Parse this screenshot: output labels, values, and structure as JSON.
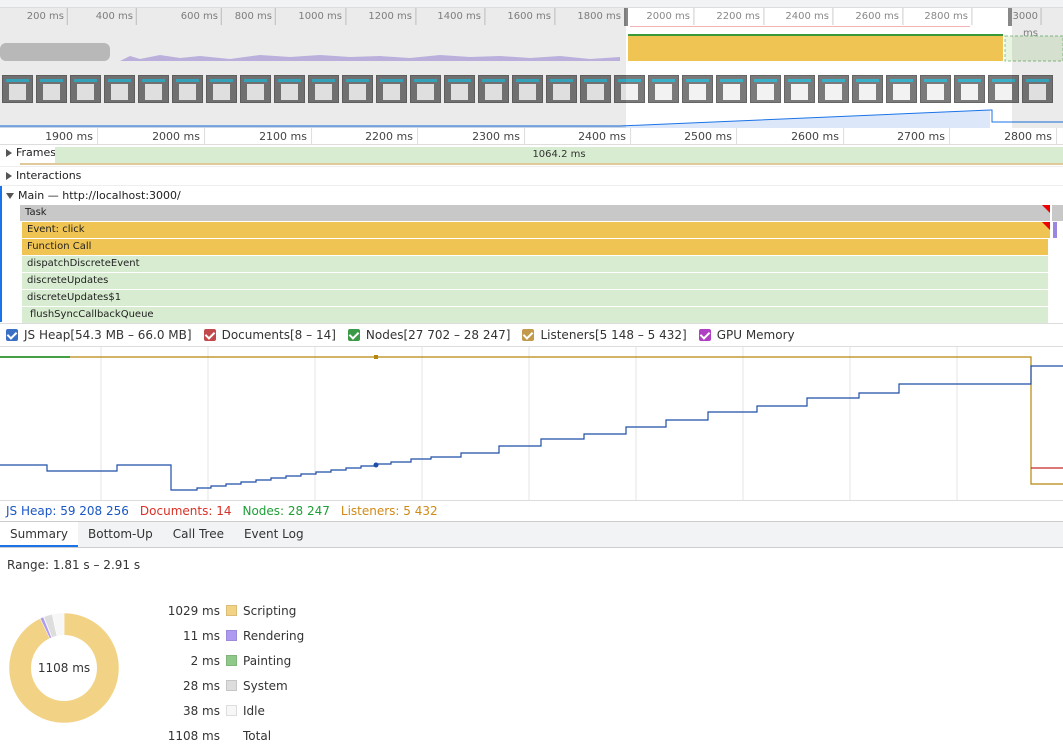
{
  "overview": {
    "ticks": [
      "200 ms",
      "400 ms",
      "600 ms",
      "800 ms",
      "1000 ms",
      "1200 ms",
      "1400 ms",
      "1600 ms",
      "1800 ms",
      "2000 ms",
      "2200 ms",
      "2400 ms",
      "2600 ms",
      "2800 ms",
      "3000 ms"
    ]
  },
  "ruler": {
    "ticks": [
      "1900 ms",
      "2000 ms",
      "2100 ms",
      "2200 ms",
      "2300 ms",
      "2400 ms",
      "2500 ms",
      "2600 ms",
      "2700 ms",
      "2800 ms"
    ]
  },
  "tracks": {
    "frames": {
      "label": "Frames",
      "duration": "1064.2 ms"
    },
    "interactions": {
      "label": "Interactions"
    },
    "main": {
      "label": "Main — http://localhost:3000/"
    }
  },
  "flame": {
    "task": "Task",
    "event_click": "Event: click",
    "function_call": "Function Call",
    "dispatch": "dispatchDiscreteEvent",
    "discrete_updates": "discreteUpdates",
    "discrete_updates1": "discreteUpdates$1",
    "flush_sync": "flushSyncCallbackQueue"
  },
  "counters": {
    "js_heap": {
      "label": "JS Heap[54.3 MB – 66.0 MB]",
      "color": "#1a73e8"
    },
    "documents": {
      "label": "Documents[8 – 14]",
      "color": "#d93025"
    },
    "nodes": {
      "label": "Nodes[27 702 – 28 247]",
      "color": "#188038"
    },
    "listeners": {
      "label": "Listeners[5 148 – 5 432]",
      "color": "#e8a33d"
    },
    "gpu": {
      "label": "GPU Memory",
      "color": "#b03ec2"
    }
  },
  "counter_values": {
    "js_heap": "JS Heap: 59 208 256",
    "documents": "Documents: 14",
    "nodes": "Nodes: 28 247",
    "listeners": "Listeners: 5 432"
  },
  "tabs": [
    "Summary",
    "Bottom-Up",
    "Call Tree",
    "Event Log"
  ],
  "summary": {
    "range": "Range: 1.81 s – 2.91 s",
    "total_center": "1108 ms",
    "rows": [
      {
        "ms": "1029 ms",
        "label": "Scripting",
        "color": "#f2d386"
      },
      {
        "ms": "11 ms",
        "label": "Rendering",
        "color": "#af9af2"
      },
      {
        "ms": "2 ms",
        "label": "Painting",
        "color": "#8fc989"
      },
      {
        "ms": "28 ms",
        "label": "System",
        "color": "#dddddd"
      },
      {
        "ms": "38 ms",
        "label": "Idle",
        "color": "#f7f7f7"
      },
      {
        "ms": "1108 ms",
        "label": "Total",
        "color": ""
      }
    ]
  },
  "colors": {
    "heap_line": "#1f4ea8",
    "listeners_line": "#b8860b",
    "documents_line": "#c62828",
    "nodes_line": "#43a047"
  }
}
